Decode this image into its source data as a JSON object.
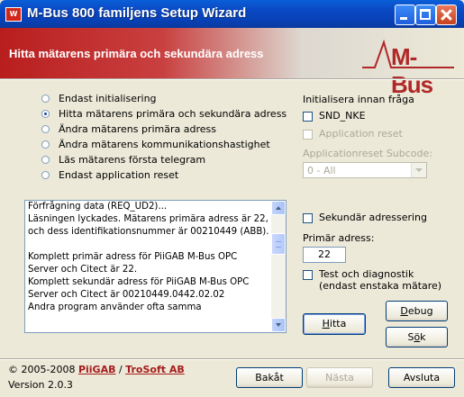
{
  "window": {
    "title": "M-Bus 800 familjens Setup Wizard",
    "icon_letter": "W"
  },
  "header": {
    "title": "Hitta mätarens primära och sekundära adress",
    "logo_text": "M-Bus"
  },
  "options": [
    {
      "label": "Endast initialisering",
      "selected": false
    },
    {
      "label": "Hitta mätarens primära och sekundära adress",
      "selected": true
    },
    {
      "label": "Ändra mätarens primära adress",
      "selected": false
    },
    {
      "label": "Ändra mätarens kommunikationshastighet",
      "selected": false
    },
    {
      "label": "Läs mätarens första telegram",
      "selected": false
    },
    {
      "label": "Endast application reset",
      "selected": false
    }
  ],
  "init": {
    "heading": "Initialisera innan fråga",
    "snd_nke": "SND_NKE",
    "app_reset": "Application reset",
    "subcode_label": "Applicationreset Subcode:",
    "subcode_value": "0 - All"
  },
  "log": {
    "text": "Förfrågning data (REQ_UD2)...\nLäsningen lyckades. Mätarens primära adress är 22, och dess identifikationsnummer är 00210449 (ABB).\n\nKomplett primär adress för PiiGAB M-Bus OPC Server och Citect är 22.\nKomplett sekundär adress för PiiGAB M-Bus OPC Server och Citect är 00210449.0442.02.02\nAndra program använder ofta samma"
  },
  "secondary": {
    "label": "Sekundär adressering"
  },
  "primary": {
    "label": "Primär adress:",
    "value": "22"
  },
  "diag": {
    "line1": "Test och diagnostik",
    "line2": "(endast enstaka mätare)"
  },
  "buttons": {
    "debug": "ebug",
    "debug_key": "D",
    "hitta": "itta",
    "hitta_key": "H",
    "sok_pre": "S",
    "sok_key": "ö",
    "sok_post": "k",
    "back": "Bakåt",
    "next": "Nästa",
    "finish": "Avsluta"
  },
  "footer": {
    "copyright": "© 2005-2008 ",
    "brand1": "PiiGAB",
    "slash": " / ",
    "brand2": "TroSoft AB",
    "version": "Version 2.0.3"
  },
  "colors": {
    "header_red": "#b91e1e",
    "xp_blue": "#0a5fd8",
    "brand_red": "#a51c1c"
  }
}
